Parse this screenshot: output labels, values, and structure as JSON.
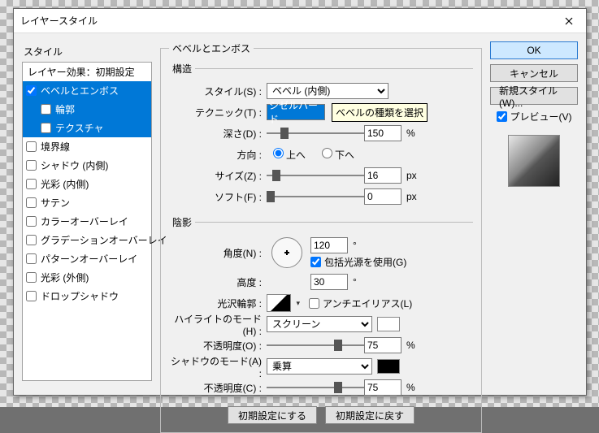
{
  "window": {
    "title": "レイヤースタイル"
  },
  "sidebar": {
    "header": "スタイル",
    "default_label": "レイヤー効果：初期設定",
    "items": [
      {
        "label": "ベベルとエンボス",
        "checked": true,
        "selected": true
      },
      {
        "label": "輪郭",
        "checked": false,
        "selected": true,
        "sub": true
      },
      {
        "label": "テクスチャ",
        "checked": false,
        "selected": true,
        "sub": true
      },
      {
        "label": "境界線",
        "checked": false
      },
      {
        "label": "シャドウ (内側)",
        "checked": false
      },
      {
        "label": "光彩 (内側)",
        "checked": false
      },
      {
        "label": "サテン",
        "checked": false
      },
      {
        "label": "カラーオーバーレイ",
        "checked": false
      },
      {
        "label": "グラデーションオーバーレイ",
        "checked": false
      },
      {
        "label": "パターンオーバーレイ",
        "checked": false
      },
      {
        "label": "光彩 (外側)",
        "checked": false
      },
      {
        "label": "ドロップシャドウ",
        "checked": false
      }
    ]
  },
  "groups": {
    "bevel": "ベベルとエンボス",
    "structure": "構造",
    "shading": "陰影"
  },
  "labels": {
    "style": "スタイル(S) :",
    "technique": "テクニック(T) :",
    "depth": "深さ(D) :",
    "direction": "方向 :",
    "dir_up": "上へ",
    "dir_down": "下へ",
    "size": "サイズ(Z) :",
    "soften": "ソフト(F) :",
    "angle": "角度(N) :",
    "altitude": "高度 :",
    "global_light": "包括光源を使用(G)",
    "gloss": "光沢輪郭 :",
    "anti_alias": "アンチエイリアス(L)",
    "highlight_mode": "ハイライトのモード(H) :",
    "opacity_h": "不透明度(O) :",
    "shadow_mode": "シャドウのモード(A) :",
    "opacity_s": "不透明度(C) :"
  },
  "values": {
    "style": "ベベル (内側)",
    "technique": "シゼルハード",
    "depth": "150",
    "depth_unit": "%",
    "size": "16",
    "size_unit": "px",
    "soften": "0",
    "soften_unit": "px",
    "angle": "120",
    "angle_unit": "°",
    "altitude": "30",
    "altitude_unit": "°",
    "highlight_mode": "スクリーン",
    "highlight_color": "#ffffff",
    "opacity_h": "75",
    "opacity_h_unit": "%",
    "shadow_mode": "乗算",
    "shadow_color": "#000000",
    "opacity_s": "75",
    "opacity_s_unit": "%",
    "global_light_checked": true,
    "anti_alias_checked": false,
    "direction": "up"
  },
  "tooltip": "ベベルの種類を選択",
  "footer": {
    "make_default": "初期設定にする",
    "reset_default": "初期設定に戻す"
  },
  "right": {
    "ok": "OK",
    "cancel": "キャンセル",
    "new_style": "新規スタイル(W)...",
    "preview": "プレビュー(V)",
    "preview_checked": true
  }
}
